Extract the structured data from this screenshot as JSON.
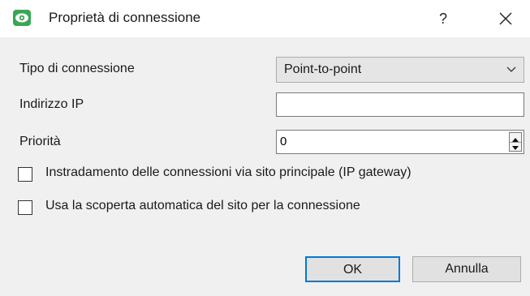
{
  "window": {
    "title": "Proprietà di connessione",
    "help": "?",
    "close_icon": "close-icon",
    "app_icon": "eye-icon",
    "accent_color": "#3aa655"
  },
  "form": {
    "connection_type": {
      "label": "Tipo di connessione",
      "value": "Point-to-point"
    },
    "ip_address": {
      "label": "Indirizzo IP",
      "value": ""
    },
    "priority": {
      "label": "Priorità",
      "value": "0"
    },
    "checkboxes": [
      {
        "label": "Instradamento delle connessioni via sito principale (IP gateway)",
        "checked": false
      },
      {
        "label": "Usa la scoperta automatica del sito per la connessione",
        "checked": false
      }
    ]
  },
  "buttons": {
    "ok": "OK",
    "cancel": "Annulla",
    "focus_color": "#0078d7"
  }
}
